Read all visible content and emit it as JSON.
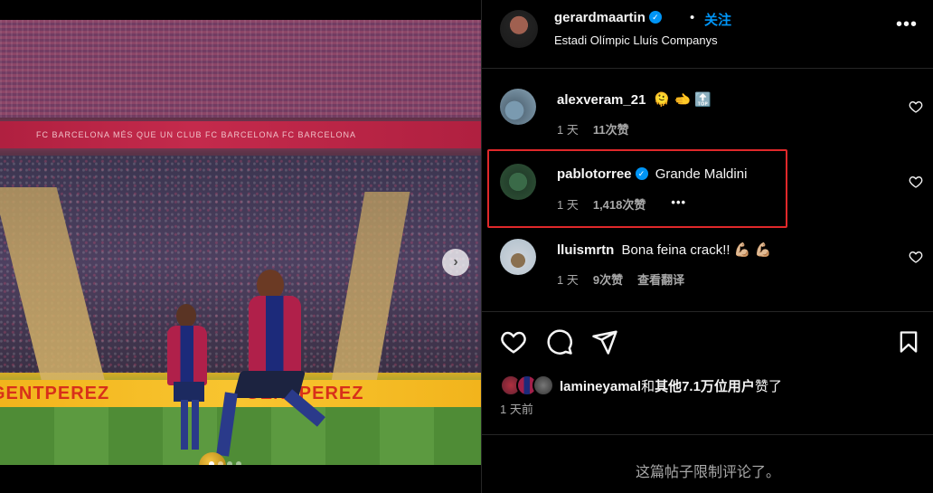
{
  "media": {
    "banner_text": "FC BARCELONA   MÉS QUE UN CLUB   FC BARCELONA   FC BARCELONA",
    "ad_text_left": "GENTPEREZ",
    "ad_text_right": "GENTPEREZ",
    "next_arrow": "›",
    "slides": 4,
    "active_slide": 1
  },
  "post": {
    "author": "gerardmaartin",
    "separator": "•",
    "follow_label": "关注",
    "location": "Estadi Olímpic Lluís Companys",
    "more_label": "•••"
  },
  "comments": [
    {
      "user": "alexveram_21",
      "text": "🫠 🫲 🔝",
      "time": "1 天",
      "likes": "11次赞",
      "extra": ""
    },
    {
      "user": "pablotorree",
      "verified": true,
      "text": "Grande Maldini",
      "time": "1 天",
      "likes": "1,418次赞",
      "extra": "•••"
    },
    {
      "user": "lluismrtn",
      "text": "Bona feina crack!! 💪🏼 💪🏼",
      "time": "1 天",
      "likes": "9次赞",
      "extra": "查看翻译"
    }
  ],
  "likes": {
    "user": "lamineyamal",
    "connector": "和",
    "others": "其他7.1万位用户",
    "suffix": "赞了"
  },
  "time_ago": "1 天前",
  "footer": {
    "comments_disabled": "这篇帖子限制评论了。"
  },
  "colors": {
    "accent": "#0095f6",
    "highlight_border": "#e0282a",
    "muted_text": "#a8a8a8"
  }
}
